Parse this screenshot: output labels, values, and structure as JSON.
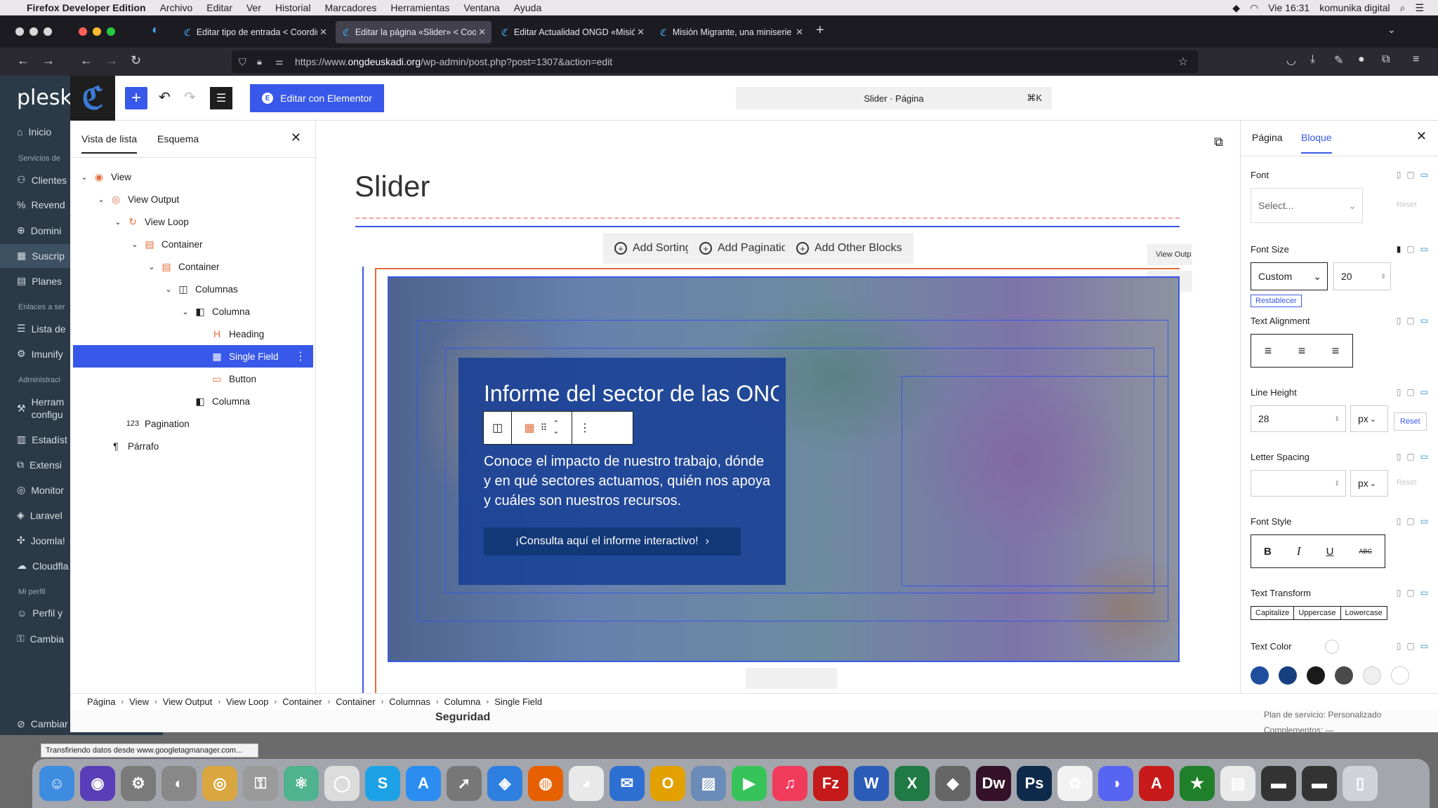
{
  "menubar": {
    "app": "Firefox Developer Edition",
    "items": [
      "Archivo",
      "Editar",
      "Ver",
      "Historial",
      "Marcadores",
      "Herramientas",
      "Ventana",
      "Ayuda"
    ],
    "clock": "Vie 16:31",
    "user": "komunika digital"
  },
  "browser": {
    "tabs": [
      {
        "title": "Editar tipo de entrada < Coordin"
      },
      {
        "title": "Editar la página «Slider» < Coor"
      },
      {
        "title": "Editar Actualidad ONGD «Misión"
      },
      {
        "title": "Misión Migrante, una miniserie c"
      }
    ],
    "url_prefix": "https://www.",
    "url_domain": "ongdeuskadi.org",
    "url_path": "/wp-admin/post.php?post=1307&action=edit"
  },
  "plesk": {
    "logo": "plesk",
    "items": [
      {
        "label": "Inicio",
        "icon": "home-icon"
      },
      {
        "section": "Servicios de"
      },
      {
        "label": "Clientes",
        "icon": "user-icon"
      },
      {
        "label": "Revend",
        "icon": "percent-icon"
      },
      {
        "label": "Domini",
        "icon": "globe-icon"
      },
      {
        "label": "Suscrip",
        "icon": "grid-icon"
      },
      {
        "label": "Planes",
        "icon": "document-icon"
      },
      {
        "section": "Enlaces a ser"
      },
      {
        "label": "Lista de",
        "icon": "list-icon"
      },
      {
        "label": "Imunify",
        "icon": "gear-icon"
      },
      {
        "section": "Administraci"
      },
      {
        "label": "Herram configu",
        "icon": "tools-icon"
      },
      {
        "label": "Estadíst",
        "icon": "chart-icon"
      },
      {
        "label": "Extensi",
        "icon": "puzzle-icon"
      },
      {
        "label": "Monitor",
        "icon": "monitor-icon"
      },
      {
        "label": "Laravel",
        "icon": "laravel-icon"
      },
      {
        "label": "Joomla!",
        "icon": "joomla-icon"
      },
      {
        "label": "Cloudfla",
        "icon": "cloud-icon"
      },
      {
        "section": "Mi perfil"
      },
      {
        "label": "Perfil y",
        "icon": "person-icon"
      },
      {
        "label": "Cambia",
        "icon": "key-icon"
      }
    ],
    "switch_view": "Cambiar vista"
  },
  "topbar": {
    "elementor_button": "Editar con Elementor",
    "command": "Slider · Página",
    "shortcut": "⌘K"
  },
  "listview": {
    "tab_list": "Vista de lista",
    "tab_outline": "Esquema",
    "tree": [
      {
        "label": "View",
        "depth": 0,
        "chevron": true,
        "icon": "view-icon"
      },
      {
        "label": "View Output",
        "depth": 1,
        "chevron": true,
        "icon": "eye-icon"
      },
      {
        "label": "View Loop",
        "depth": 2,
        "chevron": true,
        "icon": "loop-icon"
      },
      {
        "label": "Container",
        "depth": 3,
        "chevron": true,
        "icon": "container-icon"
      },
      {
        "label": "Container",
        "depth": 4,
        "chevron": true,
        "icon": "container-icon"
      },
      {
        "label": "Columnas",
        "depth": 5,
        "chevron": true,
        "icon": "columns-icon"
      },
      {
        "label": "Columna",
        "depth": 6,
        "chevron": true,
        "icon": "column-icon"
      },
      {
        "label": "Heading",
        "depth": 7,
        "chevron": false,
        "icon": "heading-icon"
      },
      {
        "label": "Single Field",
        "depth": 7,
        "chevron": false,
        "icon": "calendar-icon",
        "selected": true
      },
      {
        "label": "Button",
        "depth": 7,
        "chevron": false,
        "icon": "button-icon"
      },
      {
        "label": "Columna",
        "depth": 6,
        "chevron": false,
        "icon": "column-icon"
      },
      {
        "label": "Pagination",
        "depth": 2,
        "chevron": false,
        "icon": "pagination-icon"
      },
      {
        "label": "Párrafo",
        "depth": 1,
        "chevron": false,
        "icon": "paragraph-icon"
      }
    ]
  },
  "canvas": {
    "page_title": "Slider",
    "add_sorting": "Add Sorting",
    "add_pagination": "Add Pagination",
    "add_other": "Add Other Blocks",
    "side_label_1": "View Outp",
    "side_label_2": "View",
    "card_title": "Informe del sector de las ONGD",
    "card_text": "Conoce el impacto de nuestro trabajo, dónde y en qué sectores actuamos, quién nos apoya y cuáles son nuestros recursos.",
    "card_button": "¡Consulta aquí el informe interactivo!"
  },
  "inspector": {
    "tab_page": "Página",
    "tab_block": "Bloque",
    "font_label": "Font",
    "font_placeholder": "Select...",
    "reset": "Reset",
    "font_size_label": "Font Size",
    "font_size_unit": "Custom",
    "font_size_value": "20",
    "restablecer": "Restablecer",
    "text_alignment_label": "Text Alignment",
    "line_height_label": "Line Height",
    "line_height_value": "28",
    "px": "px",
    "letter_spacing_label": "Letter Spacing",
    "font_style_label": "Font Style",
    "text_transform_label": "Text Transform",
    "tt_capitalize": "Capitalize",
    "tt_uppercase": "Uppercase",
    "tt_lowercase": "Lowercase",
    "text_color_label": "Text Color",
    "swatches": [
      "#1f4e9e",
      "#163f80",
      "#1a1a1a",
      "#4a4a4a",
      "#efefef",
      "#ffffff"
    ]
  },
  "breadcrumbs": [
    "Página",
    "View",
    "View Output",
    "View Loop",
    "Container",
    "Container",
    "Columnas",
    "Columna",
    "Single Field"
  ],
  "below": {
    "seguridad": "Seguridad",
    "plan": "Plan de servicio: Personalizado",
    "complementos": "Complementos: —"
  },
  "status_text": "Transfiriendo datos desde www.googletagmanager.com..."
}
